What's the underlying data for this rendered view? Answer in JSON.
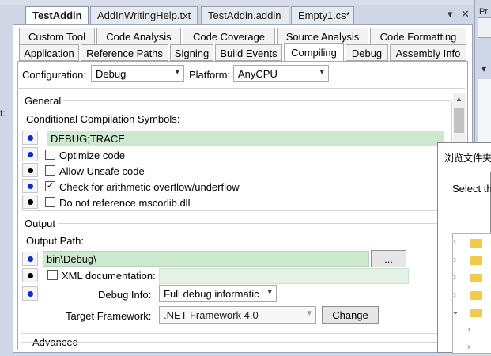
{
  "doc_tabs": [
    {
      "label": "TestAddin",
      "active": true
    },
    {
      "label": "AddInWritingHelp.txt",
      "active": false
    },
    {
      "label": "TestAddin.addin",
      "active": false
    },
    {
      "label": "Empty1.cs*",
      "active": false
    }
  ],
  "strip_controls": {
    "dropdown": "▾",
    "close": "✕"
  },
  "side": {
    "label_top": "Pr",
    "pin_arrow": "▾",
    "left_edge": "t:"
  },
  "prop_tabs_row1": [
    "Custom Tool",
    "Code Analysis",
    "Code Coverage",
    "Source Analysis",
    "Code Formatting"
  ],
  "prop_tabs_row2": [
    "Application",
    "Reference Paths",
    "Signing",
    "Build Events",
    "Compiling",
    "Debug",
    "Assembly Info"
  ],
  "active_prop_tab": "Compiling",
  "config": {
    "configuration_label": "Configuration:",
    "configuration_value": "Debug",
    "platform_label": "Platform:",
    "platform_value": "AnyCPU"
  },
  "general": {
    "title": "General",
    "symbols_label": "Conditional Compilation Symbols:",
    "symbols_value": "DEBUG;TRACE",
    "options": [
      {
        "label": "Optimize code",
        "checked": false,
        "bullet": "black"
      },
      {
        "label": "Allow Unsafe code",
        "checked": false,
        "bullet": "black"
      },
      {
        "label": "Check for arithmetic overflow/underflow",
        "checked": true,
        "bullet": "blue"
      },
      {
        "label": "Do not reference mscorlib.dll",
        "checked": false,
        "bullet": "black"
      }
    ]
  },
  "output": {
    "title": "Output",
    "path_label": "Output Path:",
    "path_value": "bin\\Debug\\",
    "browse_label": "...",
    "xml_doc_label": "XML documentation:",
    "xml_doc_checked": false,
    "xml_doc_value": "",
    "debug_info_label": "Debug Info:",
    "debug_info_value": "Full debug informatic",
    "target_label": "Target Framework:",
    "target_value": ".NET Framework 4.0",
    "change_label": "Change"
  },
  "advanced": {
    "title": "Advanced"
  },
  "dialog": {
    "title": "浏览文件夹",
    "prompt": "Select th"
  },
  "colors": {
    "accent_blue_bullet": "#0a2cd6",
    "field_green": "#cce8cf",
    "folder_yellow": "#f5c94c"
  }
}
